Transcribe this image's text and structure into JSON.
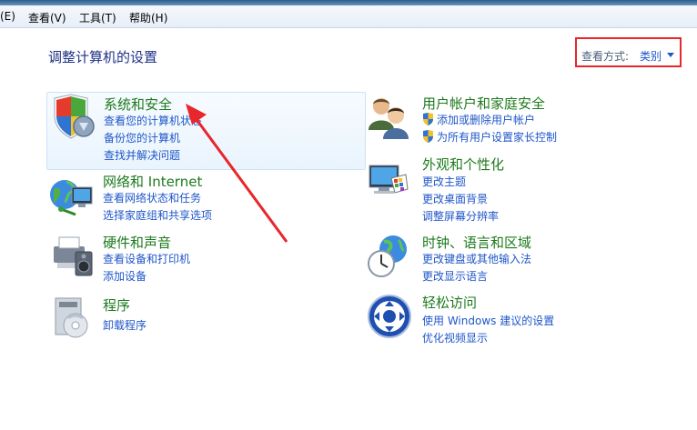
{
  "menubar": {
    "items": [
      "(E)",
      "查看(V)",
      "工具(T)",
      "帮助(H)"
    ]
  },
  "header": {
    "title": "调整计算机的设置",
    "view_by_label": "查看方式:",
    "view_by_value": "类别"
  },
  "categories": {
    "system": {
      "title": "系统和安全",
      "links": [
        "查看您的计算机状态",
        "备份您的计算机",
        "查找并解决问题"
      ]
    },
    "network": {
      "title": "网络和 Internet",
      "links": [
        "查看网络状态和任务",
        "选择家庭组和共享选项"
      ]
    },
    "hardware": {
      "title": "硬件和声音",
      "links": [
        "查看设备和打印机",
        "添加设备"
      ]
    },
    "programs": {
      "title": "程序",
      "links": [
        "卸载程序"
      ]
    },
    "users": {
      "title": "用户帐户和家庭安全",
      "links": [
        "添加或删除用户帐户",
        "为所有用户设置家长控制"
      ]
    },
    "appearance": {
      "title": "外观和个性化",
      "links": [
        "更改主题",
        "更改桌面背景",
        "调整屏幕分辨率"
      ]
    },
    "clock": {
      "title": "时钟、语言和区域",
      "links": [
        "更改键盘或其他输入法",
        "更改显示语言"
      ]
    },
    "ease": {
      "title": "轻松访问",
      "links": [
        "使用 Windows 建议的设置",
        "优化视频显示"
      ]
    }
  },
  "colors": {
    "title_green": "#1d7a1d",
    "link_blue": "#1f56c9",
    "annotation_red": "#e8262b"
  }
}
